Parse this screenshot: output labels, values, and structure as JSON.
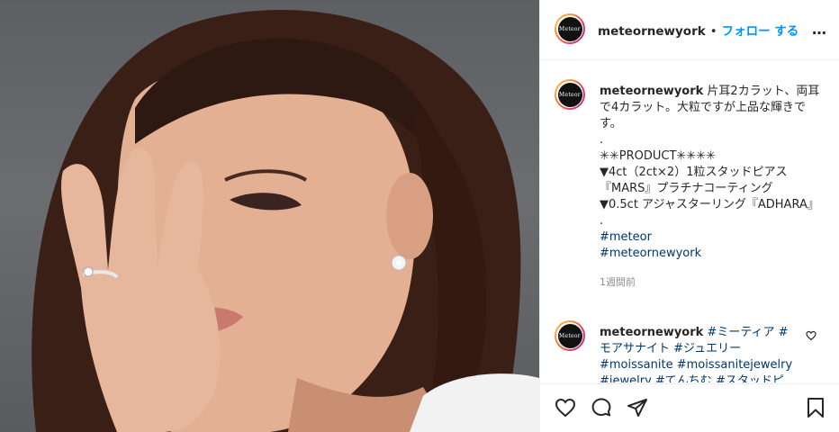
{
  "post": {
    "username": "meteornewyork",
    "follow_label": "フォロー する",
    "separator": "•",
    "more_icon": "…",
    "avatar_logo_text": "Meteor"
  },
  "caption": {
    "username": "meteornewyork",
    "lines": [
      "片耳2カラット、両耳で4カラット。大粒ですが上品な輝きです。",
      ".",
      "✳✳PRODUCT✳✳✳✳",
      "▼4ct（2ct×2）1粒スタッドピアス『MARS』プラチナコーティング",
      "▼0.5ct アジャスターリング『ADHARA』",
      ".",
      "#meteor",
      "#meteornewyork"
    ],
    "time": "1週間前"
  },
  "comment": {
    "username": "meteornewyork",
    "text": "#ミーティア #モアサナイト #ジュエリー #moissanite #moissanitejewelry #jewelry #てんちむ #スタッドピ"
  },
  "icons": {
    "like": "heart-icon",
    "comment": "comment-icon",
    "share": "share-icon",
    "save": "bookmark-icon",
    "comment_like": "heart-small-icon"
  },
  "colors": {
    "link": "#0095f6",
    "hashtag": "#00376b",
    "text": "#262626",
    "muted": "#8e8e8e"
  }
}
